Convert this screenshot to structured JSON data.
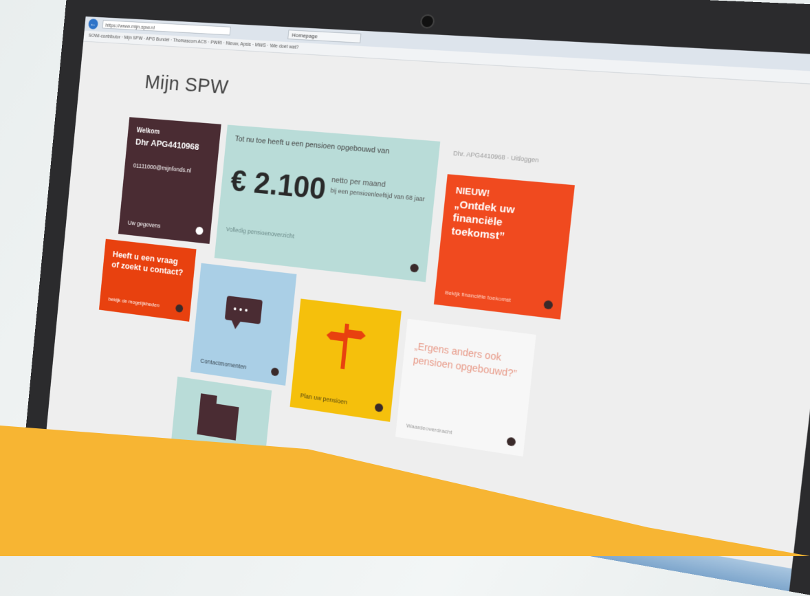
{
  "browser": {
    "url": "https://www.mijn.spw.nl",
    "tab_label": "Homepage",
    "bookmarks": "SOWI-contributor · Mijn SPW · APG Bundel · Thomascom ACS · PWRI · Nieuw, Apsis · MWS · Wie doet wat?"
  },
  "page": {
    "title": "Mijn SPW",
    "user_bar": "Dhr. APG4410968  ·  Uitloggen"
  },
  "tiles": {
    "welcome": {
      "greeting": "Welkom",
      "name": "Dhr APG4410968",
      "email": "01111000@mijnfonds.nl",
      "footer": "Uw gegevens"
    },
    "pension": {
      "intro": "Tot nu toe heeft u een pensioen opgebouwd van",
      "amount": "€ 2.100",
      "per": "netto per maand",
      "age": "bij een pensioenleeftijd van 68 jaar",
      "footer": "Volledig pensioenoverzicht"
    },
    "new": {
      "label": "NIEUW!",
      "text": "„Ontdek uw financiële toekomst”",
      "footer": "Bekijk financiële toekomst"
    },
    "question": {
      "text": "Heeft u een vraag of zoekt u contact?",
      "footer": "bekijk de mogelijkheden"
    },
    "contact": {
      "footer": "Contactmomenten"
    },
    "plan": {
      "footer": "Plan uw pensioen"
    },
    "else": {
      "text": "„Ergens anders ook pensioen opgebouwd?”",
      "footer": "Waardeoverdracht"
    }
  },
  "colors": {
    "maroon": "#4a2c33",
    "mint": "#b9dcd8",
    "orange": "#f04a1f",
    "yellow": "#f5c00c",
    "light_blue": "#aacfe6",
    "band_yellow": "#f7b533"
  }
}
